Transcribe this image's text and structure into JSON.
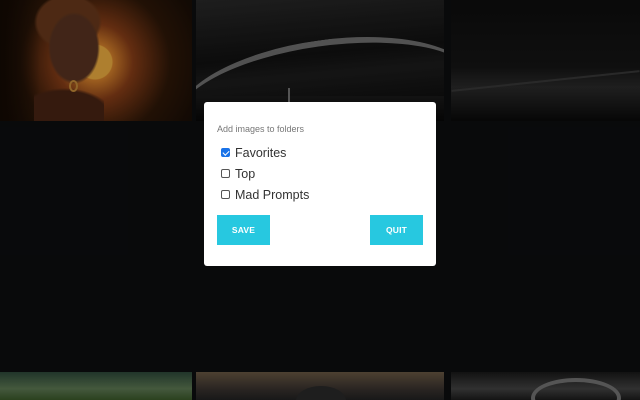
{
  "dialog": {
    "title": "Add images to folders",
    "folders": [
      {
        "label": "Favorites",
        "checked": true
      },
      {
        "label": "Top",
        "checked": false
      },
      {
        "label": "Mad Prompts",
        "checked": false
      }
    ],
    "save_label": "SAVE",
    "quit_label": "QUIT"
  },
  "colors": {
    "accent": "#27c8e0",
    "page_background": "#0d0e10",
    "dialog_background": "#ffffff"
  }
}
